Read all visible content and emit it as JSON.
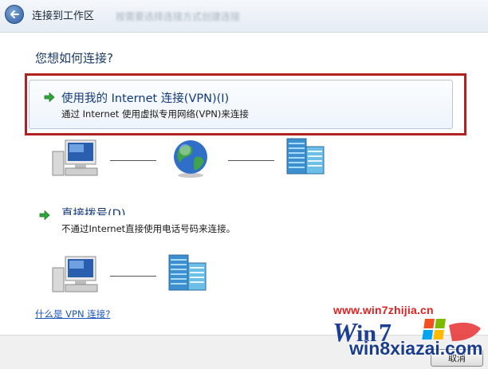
{
  "window": {
    "title": "连接到工作区",
    "blurred_banner": "按需要选择连接方式创建连接"
  },
  "question": "您想如何连接?",
  "options": [
    {
      "title": "使用我的 Internet 连接(VPN)(I)",
      "description": "通过 Internet 使用虚拟专用网络(VPN)来连接"
    },
    {
      "title": "直接拨号(D)",
      "description": "不通过Internet直接使用电话号码来连接。"
    }
  ],
  "help_link": "什么是 VPN 连接?",
  "cancel_label": "取消",
  "watermarks": {
    "site1": "www.win7zhijia.cn",
    "site2": "win8xiazai.com"
  },
  "icons": [
    "back-arrow-icon",
    "green-arrow-icon",
    "computer-icon",
    "globe-icon",
    "office-building-icon",
    "windows-flag-icon"
  ],
  "colors": {
    "highlight": "#b32020",
    "link": "#1a55b8",
    "heading": "#1b3a66"
  }
}
